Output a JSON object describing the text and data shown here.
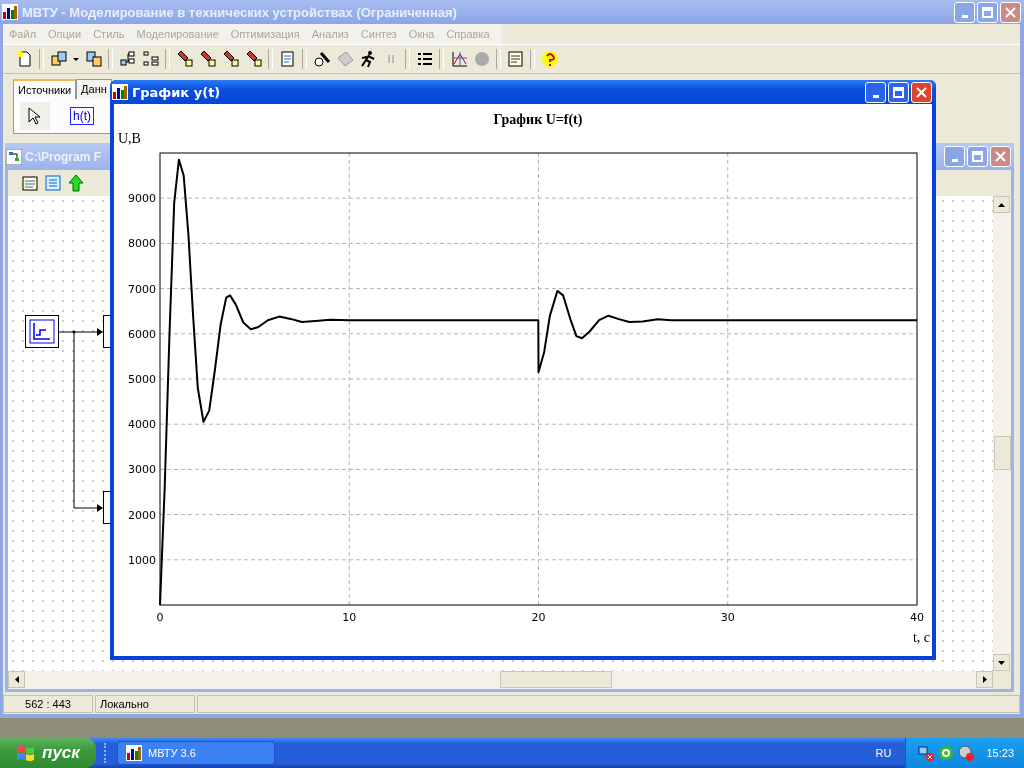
{
  "main_window": {
    "title": "МВТУ - Моделирование в технических устройствах (Ограниченная)",
    "menu": [
      {
        "label": "Файл",
        "disabled": true
      },
      {
        "label": "Опции",
        "disabled": true
      },
      {
        "label": "Стиль",
        "disabled": true
      },
      {
        "label": "Моделирование",
        "disabled": true
      },
      {
        "label": "Оптимизация",
        "disabled": true
      },
      {
        "label": "Анализ",
        "disabled": true
      },
      {
        "label": "Синтез",
        "disabled": true
      },
      {
        "label": "Окна",
        "disabled": true
      },
      {
        "label": "Справка",
        "disabled": true
      }
    ],
    "palette_tabs": [
      {
        "label": "Источники",
        "selected": true
      },
      {
        "label": "Данн",
        "selected": false
      }
    ],
    "palette_block_label": "h(t)",
    "child_window": {
      "title": "C:\\Program F"
    },
    "status_bar": [
      "562 : 443",
      "Локально"
    ]
  },
  "graph_window": {
    "title": "График y(t)",
    "chart_data": {
      "type": "line",
      "title": "График U=f(t)",
      "xlabel": "t, c",
      "ylabel": "U,B",
      "xlim": [
        0,
        40
      ],
      "ylim": [
        0,
        10000
      ],
      "xticks": [
        0,
        10,
        20,
        30,
        40
      ],
      "yticks": [
        1000,
        2000,
        3000,
        4000,
        5000,
        6000,
        7000,
        8000,
        9000
      ],
      "x": [
        0,
        0.25,
        0.5,
        0.75,
        1.0,
        1.25,
        1.5,
        1.75,
        2.0,
        2.3,
        2.6,
        2.9,
        3.2,
        3.5,
        3.7,
        4.0,
        4.4,
        4.8,
        5.2,
        5.7,
        6.3,
        6.9,
        7.5,
        8.2,
        9.0,
        10,
        19.99,
        20,
        20.3,
        20.6,
        21.0,
        21.3,
        21.7,
        22.0,
        22.3,
        22.7,
        23.2,
        23.7,
        24.2,
        24.8,
        25.5,
        26.3,
        27,
        40
      ],
      "grid": true,
      "series": [
        {
          "color": "#000000",
          "values": [
            0,
            2600,
            6000,
            8900,
            9850,
            9500,
            8200,
            6400,
            4800,
            4050,
            4300,
            5200,
            6200,
            6800,
            6850,
            6650,
            6250,
            6100,
            6150,
            6300,
            6380,
            6330,
            6260,
            6280,
            6310,
            6300,
            6300,
            5150,
            5600,
            6400,
            6950,
            6850,
            6300,
            5950,
            5900,
            6050,
            6300,
            6400,
            6330,
            6260,
            6270,
            6320,
            6300,
            6300
          ]
        }
      ]
    }
  },
  "taskbar": {
    "start_label": "пуск",
    "tasks": [
      {
        "label": "МВТУ 3.6",
        "selected": false
      }
    ],
    "language": "RU",
    "clock": "15:23"
  }
}
